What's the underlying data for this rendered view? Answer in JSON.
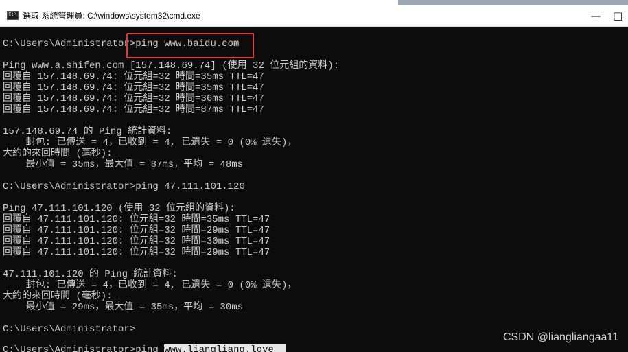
{
  "window": {
    "title": "選取 系統管理員: C:\\windows\\system32\\cmd.exe",
    "icon": "cmd-icon",
    "icon_text": "C:\\",
    "minimize_symbol": "—",
    "maximize_symbol": "□"
  },
  "console": {
    "lines": [
      "C:\\Users\\Administrator>ping www.baidu.com",
      "",
      "Ping www.a.shifen.com [157.148.69.74] (使用 32 位元組的資料):",
      "回覆自 157.148.69.74: 位元組=32 時間=35ms TTL=47",
      "回覆自 157.148.69.74: 位元組=32 時間=35ms TTL=47",
      "回覆自 157.148.69.74: 位元組=32 時間=36ms TTL=47",
      "回覆自 157.148.69.74: 位元組=32 時間=87ms TTL=47",
      "",
      "157.148.69.74 的 Ping 統計資料:",
      "    封包: 已傳送 = 4，已收到 = 4, 已遺失 = 0 (0% 遺失)，",
      "大約的來回時間 (毫秒):",
      "    最小值 = 35ms，最大值 = 87ms，平均 = 48ms",
      "",
      "C:\\Users\\Administrator>ping 47.111.101.120",
      "",
      "Ping 47.111.101.120 (使用 32 位元組的資料):",
      "回覆自 47.111.101.120: 位元組=32 時間=35ms TTL=47",
      "回覆自 47.111.101.120: 位元組=32 時間=29ms TTL=47",
      "回覆自 47.111.101.120: 位元組=32 時間=30ms TTL=47",
      "回覆自 47.111.101.120: 位元組=32 時間=29ms TTL=47",
      "",
      "47.111.101.120 的 Ping 統計資料:",
      "    封包: 已傳送 = 4，已收到 = 4, 已遺失 = 0 (0% 遺失)，",
      "大約的來回時間 (毫秒):",
      "    最小值 = 29ms，最大值 = 35ms，平均 = 30ms",
      "",
      "C:\\Users\\Administrator>"
    ],
    "last_line": {
      "prefix": "C:\\Users\\Administrator>ping ",
      "selected": "www.liangliang.love  "
    }
  },
  "watermark": "CSDN @liangliangaa11",
  "colors": {
    "console_bg": "#0c0c0c",
    "console_text": "#cccccc",
    "highlight_box": "#e53935"
  }
}
